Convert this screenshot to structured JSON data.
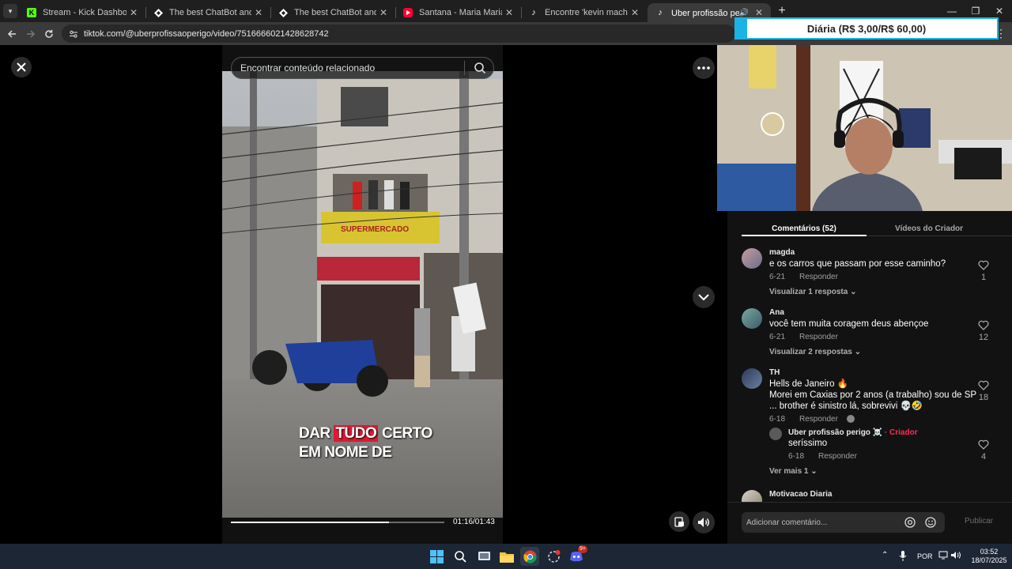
{
  "browser": {
    "tabs": [
      {
        "title": "Stream - Kick Dashboard",
        "favicon": "kick-icon",
        "favicon_color": "#53fc18"
      },
      {
        "title": "The best ChatBot and Widgets",
        "favicon": "diamond-icon",
        "favicon_color": "#ffffff"
      },
      {
        "title": "The best ChatBot and Widgets",
        "favicon": "diamond-icon",
        "favicon_color": "#ffffff"
      },
      {
        "title": "Santana - Maria Maria (Official",
        "favicon": "youtube-icon",
        "favicon_color": "#ff0033"
      },
      {
        "title": "Encontre 'kevin machuca' no Tik",
        "favicon": "tiktok-icon",
        "favicon_color": "#ffffff"
      },
      {
        "title": "Uber profissão perigo ☠️ (",
        "favicon": "tiktok-icon",
        "favicon_color": "#ffffff",
        "active": true
      }
    ],
    "url_host": "tiktok.com",
    "url_path": "/@uberprofissaoperigo/video/7516666021428628742"
  },
  "overlay": {
    "banner": "Diária (R$ 3,00/R$ 60,00)",
    "accent": "#1bb3e6"
  },
  "video": {
    "search_placeholder": "Encontrar conteúdo relacionado",
    "caption_line1_a": "DAR ",
    "caption_line1_hl": "TUDO",
    "caption_line1_b": " CERTO",
    "caption_line2": "EM NOME DE",
    "time": "01:16/01:43",
    "progress": 0.74,
    "caption_highlight_color": "#d91b34"
  },
  "comments_panel": {
    "tabs": {
      "comments": "Comentários (52)",
      "creator_videos": "Vídeos do Criador"
    },
    "comments": [
      {
        "user": "magda",
        "text": "e os carros que passam por esse caminho?",
        "date": "6-21",
        "reply": "Responder",
        "likes": "1",
        "view_replies": "Visualizar 1 resposta"
      },
      {
        "user": "Ana",
        "text": "você tem muita coragem deus abençoe",
        "date": "6-21",
        "reply": "Responder",
        "likes": "12",
        "view_replies": "Visualizar 2 respostas"
      },
      {
        "user": "TH",
        "text_lines": [
          "Hells de Janeiro 🔥",
          "Morei em Caxias por 2 anos (a trabalho) sou de SP",
          "... brother é sinistro lá, sobrevivi 💀🤣"
        ],
        "date": "6-18",
        "reply": "Responder",
        "likes": "18",
        "subreply": {
          "user": "Uber profissão perigo ☠️",
          "creator_tag": "· Criador",
          "text": "seríssimo",
          "date": "6-18",
          "reply": "Responder",
          "likes": "4"
        },
        "view_more": "Ver mais 1"
      },
      {
        "user": "Motivacao Diaria"
      }
    ],
    "comment_placeholder": "Adicionar comentário...",
    "publish": "Publicar",
    "creator_color": "#fe2c55"
  },
  "taskbar": {
    "language": "POR",
    "time": "03:52",
    "date": "18/07/2025",
    "badge": "9+"
  }
}
